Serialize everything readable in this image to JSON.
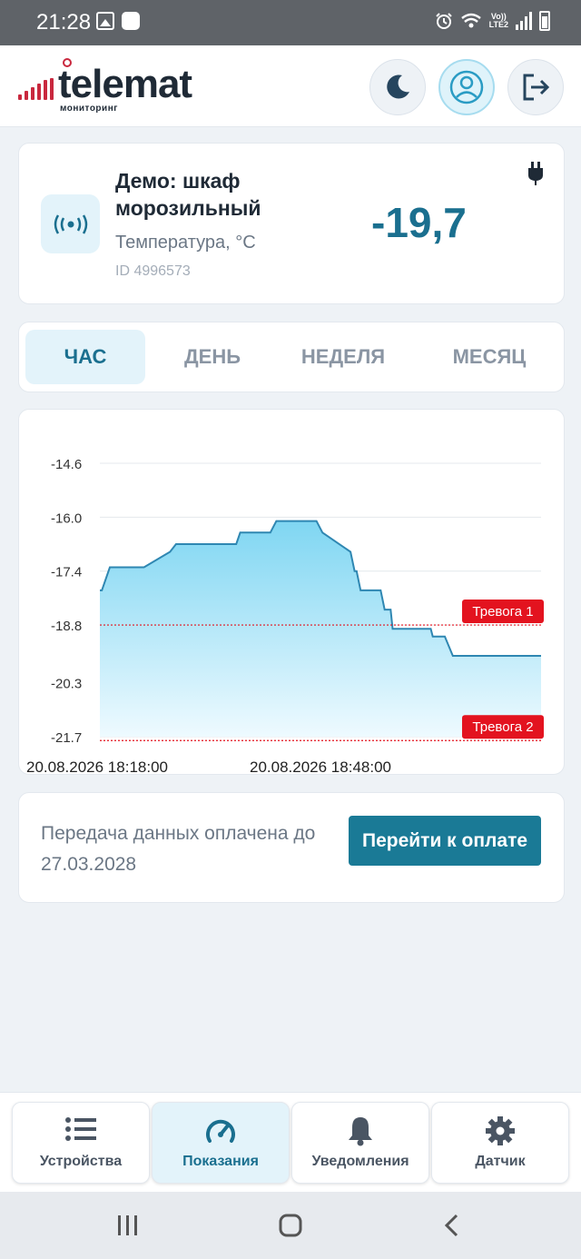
{
  "status_bar": {
    "time": "21:28",
    "network": "Vo)) LTE2"
  },
  "header": {
    "logo_text": "telemat",
    "logo_sub": "мониторинг",
    "buttons": [
      "moon-icon",
      "user-icon",
      "logout-icon"
    ]
  },
  "device": {
    "name": "Демо: шкаф морозильный",
    "parameter": "Температура, °С",
    "id": "ID 4996573",
    "value": "-19,7"
  },
  "tabs": [
    "ЧАС",
    "ДЕНЬ",
    "НЕДЕЛЯ",
    "МЕСЯЦ"
  ],
  "active_tab": "ЧАС",
  "chart_data": {
    "type": "area",
    "y_ticks": [
      "-14.6",
      "-16.0",
      "-17.4",
      "-18.8",
      "-20.3",
      "-21.7"
    ],
    "ylim": [
      -21.7,
      -14.6
    ],
    "x_tick_labels": [
      "20.08.2026 18:18:00",
      "20.08.2026 18:48:00"
    ],
    "x_minutes": [
      0,
      1,
      5,
      8,
      20,
      22,
      35,
      38,
      68,
      70,
      85,
      87,
      88,
      91,
      108,
      111,
      125,
      127,
      128,
      130,
      140,
      142,
      145,
      146,
      150,
      162,
      165,
      166,
      172,
      176,
      179,
      220
    ],
    "y": [
      -17.9,
      -17.9,
      -17.3,
      -17.3,
      -17.3,
      -17.3,
      -16.9,
      -16.7,
      -16.7,
      -16.4,
      -16.4,
      -16.2,
      -16.1,
      -16.1,
      -16.1,
      -16.4,
      -16.9,
      -17.4,
      -17.4,
      -17.9,
      -17.9,
      -18.4,
      -18.4,
      -18.9,
      -18.9,
      -18.9,
      -18.9,
      -19.1,
      -19.1,
      -19.6,
      -19.6,
      -19.6
    ],
    "thresholds": [
      {
        "label": "Тревога 1",
        "value": -18.8
      },
      {
        "label": "Тревога 2",
        "value": -21.8
      }
    ],
    "colors": {
      "line": "#2f87b2",
      "fill_top": "#7fd6f2",
      "fill_bottom": "#eefaff",
      "alarm": "#e3131f"
    },
    "grid": true
  },
  "payment": {
    "text": "Передача данных оплачена до 27.03.2028",
    "button": "Перейти к оплате"
  },
  "bottom_nav": [
    {
      "label": "Устройства",
      "icon": "list-icon"
    },
    {
      "label": "Показания",
      "icon": "gauge-icon"
    },
    {
      "label": "Уведомления",
      "icon": "bell-icon"
    },
    {
      "label": "Датчик",
      "icon": "gear-icon"
    }
  ],
  "active_nav": "Показания"
}
